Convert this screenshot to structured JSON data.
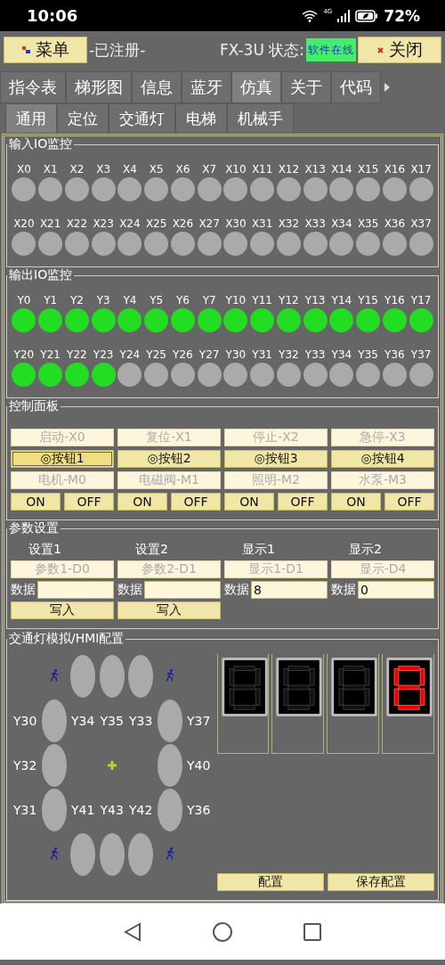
{
  "status_bar": {
    "time": "10:06",
    "network": "4G",
    "battery": "72%"
  },
  "top_bar": {
    "menu": "菜单",
    "registration": "-已注册-",
    "status_label": "FX-3U 状态:",
    "status": "软件在线",
    "close": "关闭"
  },
  "tabs": [
    {
      "label": "指令表",
      "selected": false
    },
    {
      "label": "梯形图",
      "selected": false
    },
    {
      "label": "信息",
      "selected": false
    },
    {
      "label": "蓝牙",
      "selected": false
    },
    {
      "label": "仿真",
      "selected": true
    },
    {
      "label": "关于",
      "selected": false
    },
    {
      "label": "代码",
      "selected": false
    }
  ],
  "sub_tabs": [
    {
      "label": "通用",
      "selected": true
    },
    {
      "label": "定位",
      "selected": false
    },
    {
      "label": "交通灯",
      "selected": false
    },
    {
      "label": "电梯",
      "selected": false
    },
    {
      "label": "机械手",
      "selected": false
    }
  ],
  "input_io": {
    "title": "输入IO监控",
    "points": [
      {
        "label": "X0",
        "on": false
      },
      {
        "label": "X1",
        "on": false
      },
      {
        "label": "X2",
        "on": false
      },
      {
        "label": "X3",
        "on": false
      },
      {
        "label": "X4",
        "on": false
      },
      {
        "label": "X5",
        "on": false
      },
      {
        "label": "X6",
        "on": false
      },
      {
        "label": "X7",
        "on": false
      },
      {
        "label": "X10",
        "on": false
      },
      {
        "label": "X11",
        "on": false
      },
      {
        "label": "X12",
        "on": false
      },
      {
        "label": "X13",
        "on": false
      },
      {
        "label": "X14",
        "on": false
      },
      {
        "label": "X15",
        "on": false
      },
      {
        "label": "X16",
        "on": false
      },
      {
        "label": "X17",
        "on": false
      },
      {
        "label": "X20",
        "on": false
      },
      {
        "label": "X21",
        "on": false
      },
      {
        "label": "X22",
        "on": false
      },
      {
        "label": "X23",
        "on": false
      },
      {
        "label": "X24",
        "on": false
      },
      {
        "label": "X25",
        "on": false
      },
      {
        "label": "X26",
        "on": false
      },
      {
        "label": "X27",
        "on": false
      },
      {
        "label": "X30",
        "on": false
      },
      {
        "label": "X31",
        "on": false
      },
      {
        "label": "X32",
        "on": false
      },
      {
        "label": "X33",
        "on": false
      },
      {
        "label": "X34",
        "on": false
      },
      {
        "label": "X35",
        "on": false
      },
      {
        "label": "X36",
        "on": false
      },
      {
        "label": "X37",
        "on": false
      }
    ]
  },
  "output_io": {
    "title": "输出IO监控",
    "points": [
      {
        "label": "Y0",
        "on": true
      },
      {
        "label": "Y1",
        "on": true
      },
      {
        "label": "Y2",
        "on": true
      },
      {
        "label": "Y3",
        "on": true
      },
      {
        "label": "Y4",
        "on": true
      },
      {
        "label": "Y5",
        "on": true
      },
      {
        "label": "Y6",
        "on": true
      },
      {
        "label": "Y7",
        "on": true
      },
      {
        "label": "Y10",
        "on": true
      },
      {
        "label": "Y11",
        "on": true
      },
      {
        "label": "Y12",
        "on": true
      },
      {
        "label": "Y13",
        "on": true
      },
      {
        "label": "Y14",
        "on": true
      },
      {
        "label": "Y15",
        "on": true
      },
      {
        "label": "Y16",
        "on": true
      },
      {
        "label": "Y17",
        "on": true
      },
      {
        "label": "Y20",
        "on": true
      },
      {
        "label": "Y21",
        "on": true
      },
      {
        "label": "Y22",
        "on": true
      },
      {
        "label": "Y23",
        "on": true
      },
      {
        "label": "Y24",
        "on": false
      },
      {
        "label": "Y25",
        "on": false
      },
      {
        "label": "Y26",
        "on": false
      },
      {
        "label": "Y27",
        "on": false
      },
      {
        "label": "Y30",
        "on": false
      },
      {
        "label": "Y31",
        "on": false
      },
      {
        "label": "Y32",
        "on": false
      },
      {
        "label": "Y33",
        "on": false
      },
      {
        "label": "Y34",
        "on": false
      },
      {
        "label": "Y35",
        "on": false
      },
      {
        "label": "Y36",
        "on": false
      },
      {
        "label": "Y37",
        "on": false
      }
    ]
  },
  "control_panel": {
    "title": "控制面板",
    "inputs": [
      {
        "label": "启动-X0",
        "disabled": true
      },
      {
        "label": "复位-X1",
        "disabled": true
      },
      {
        "label": "停止-X2",
        "disabled": true
      },
      {
        "label": "急停-X3",
        "disabled": true
      }
    ],
    "buttons": [
      {
        "label": "◎按钮1",
        "selected": true
      },
      {
        "label": "◎按钮2",
        "selected": false
      },
      {
        "label": "◎按钮3",
        "selected": false
      },
      {
        "label": "◎按钮4",
        "selected": false
      }
    ],
    "outputs": [
      {
        "label": "电机-M0",
        "disabled": true
      },
      {
        "label": "电磁阀-M1",
        "disabled": true
      },
      {
        "label": "照明-M2",
        "disabled": true
      },
      {
        "label": "水泵-M3",
        "disabled": true
      }
    ],
    "switches": [
      "ON",
      "OFF",
      "ON",
      "OFF",
      "ON",
      "OFF",
      "ON",
      "OFF"
    ]
  },
  "parameters": {
    "title": "参数设置",
    "columns": [
      {
        "heading": "设置1",
        "address": "参数1-D0",
        "disabled": true,
        "data_label": "数据",
        "write": "写入"
      },
      {
        "heading": "设置2",
        "address": "参数2-D1",
        "disabled": true,
        "data_label": "数据",
        "write": "写入"
      },
      {
        "heading": "显示1",
        "address": "显示1-D1",
        "disabled": true,
        "data_label": "数据",
        "value": "8"
      },
      {
        "heading": "显示2",
        "address": "显示-D4",
        "disabled": true,
        "data_label": "数据",
        "value": "0"
      }
    ]
  },
  "traffic": {
    "title": "交通灯模拟/HMI配置",
    "top_lights": [
      {
        "on": false
      },
      {
        "on": false
      },
      {
        "on": false
      }
    ],
    "top_labels": [
      "Y34",
      "Y35",
      "Y33"
    ],
    "left": [
      {
        "label": "Y30",
        "on": false
      },
      {
        "label": "Y32",
        "on": false
      },
      {
        "label": "Y31",
        "on": false
      }
    ],
    "right": [
      {
        "label": "Y37",
        "on": false
      },
      {
        "label": "Y40",
        "on": false
      },
      {
        "label": "Y36",
        "on": false
      }
    ],
    "bottom_labels": [
      "Y41",
      "Y43",
      "Y42"
    ],
    "bottom_lights": [
      {
        "on": false
      },
      {
        "on": false
      },
      {
        "on": false
      }
    ],
    "displays": [
      {
        "lit": false
      },
      {
        "lit": false
      },
      {
        "lit": false
      },
      {
        "lit": true
      }
    ],
    "buttons": [
      "配置",
      "保存配置"
    ]
  }
}
